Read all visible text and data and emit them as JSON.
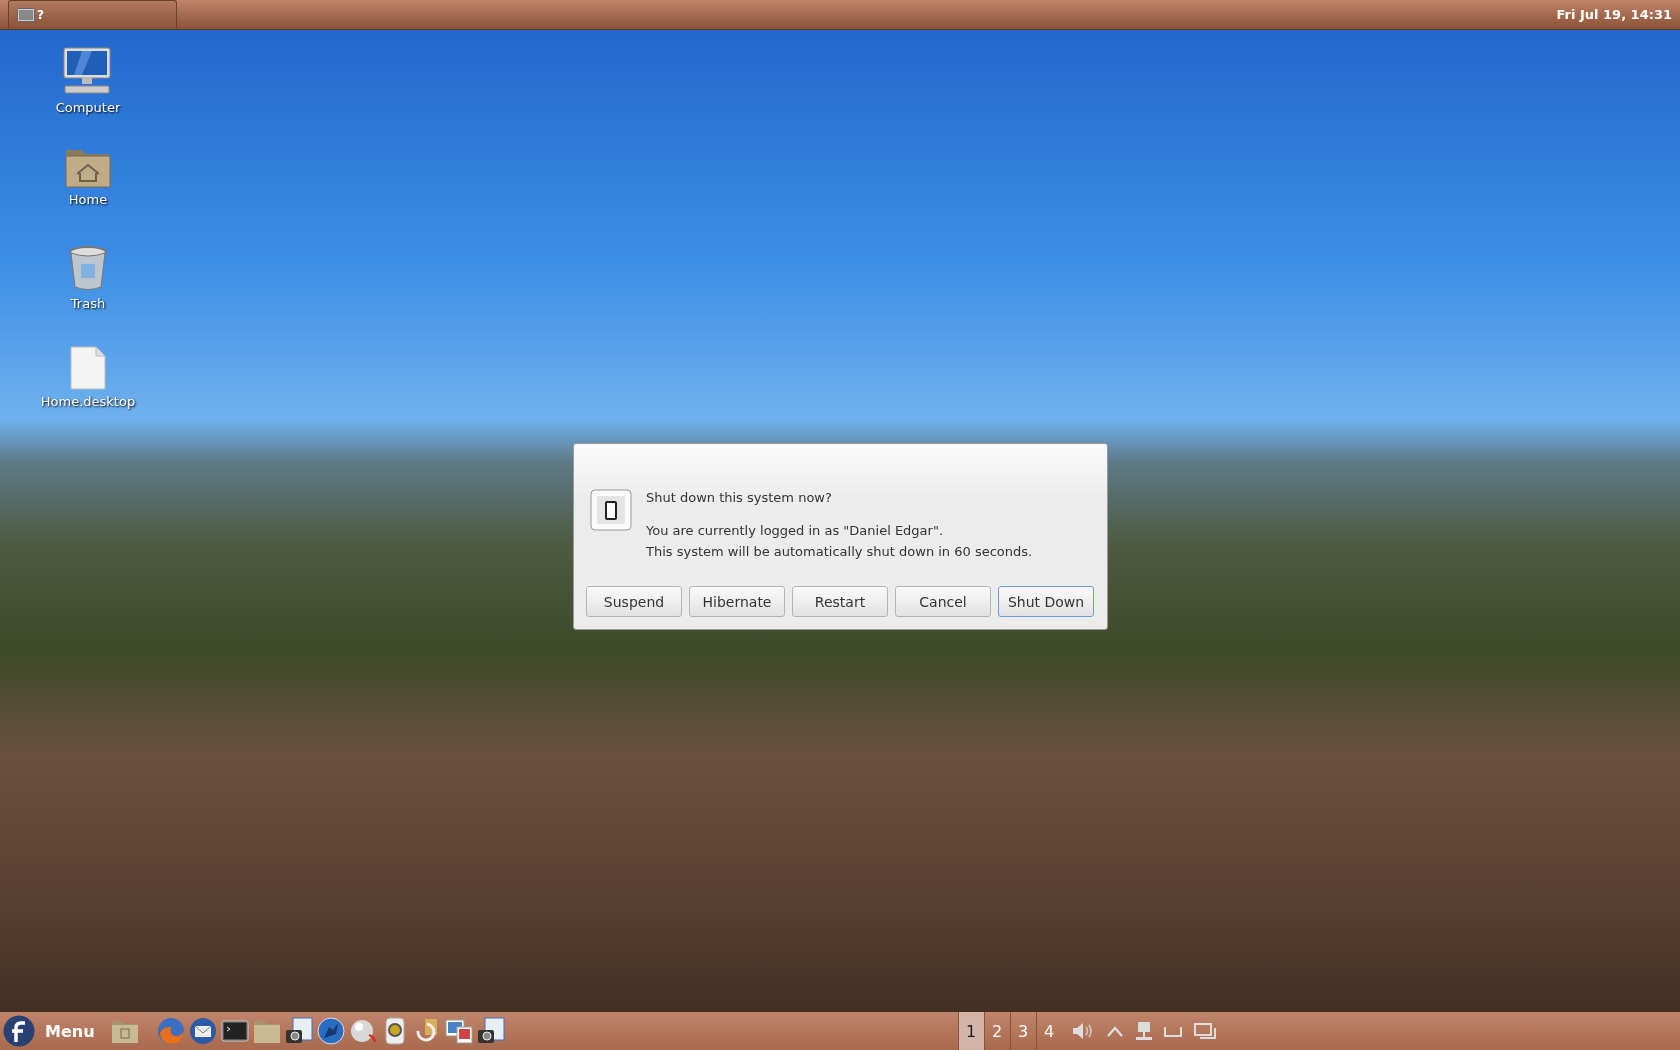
{
  "top_panel": {
    "window_button": {
      "label": "?"
    },
    "clock": "Fri Jul 19, 14:31"
  },
  "desktop_icons": [
    {
      "kind": "computer",
      "label": "Computer"
    },
    {
      "kind": "home",
      "label": "Home"
    },
    {
      "kind": "trash",
      "label": "Trash"
    },
    {
      "kind": "file",
      "label": "Home.desktop"
    }
  ],
  "dialog": {
    "title": "Shut down this system now?",
    "message_lines": [
      "You are currently logged in as \"Daniel Edgar\".",
      "This system will be automatically shut down in 60 seconds."
    ],
    "buttons": [
      {
        "label": "Suspend",
        "selected": false
      },
      {
        "label": "Hibernate",
        "selected": false
      },
      {
        "label": "Restart",
        "selected": false
      },
      {
        "label": "Cancel",
        "selected": false
      },
      {
        "label": "Shut Down",
        "selected": true
      }
    ]
  },
  "taskbar": {
    "menu": {
      "label": "Menu"
    },
    "workspaces": [
      {
        "label": "1",
        "selected": true
      },
      {
        "label": "2",
        "selected": false
      },
      {
        "label": "3",
        "selected": false
      },
      {
        "label": "4",
        "selected": false
      }
    ]
  }
}
